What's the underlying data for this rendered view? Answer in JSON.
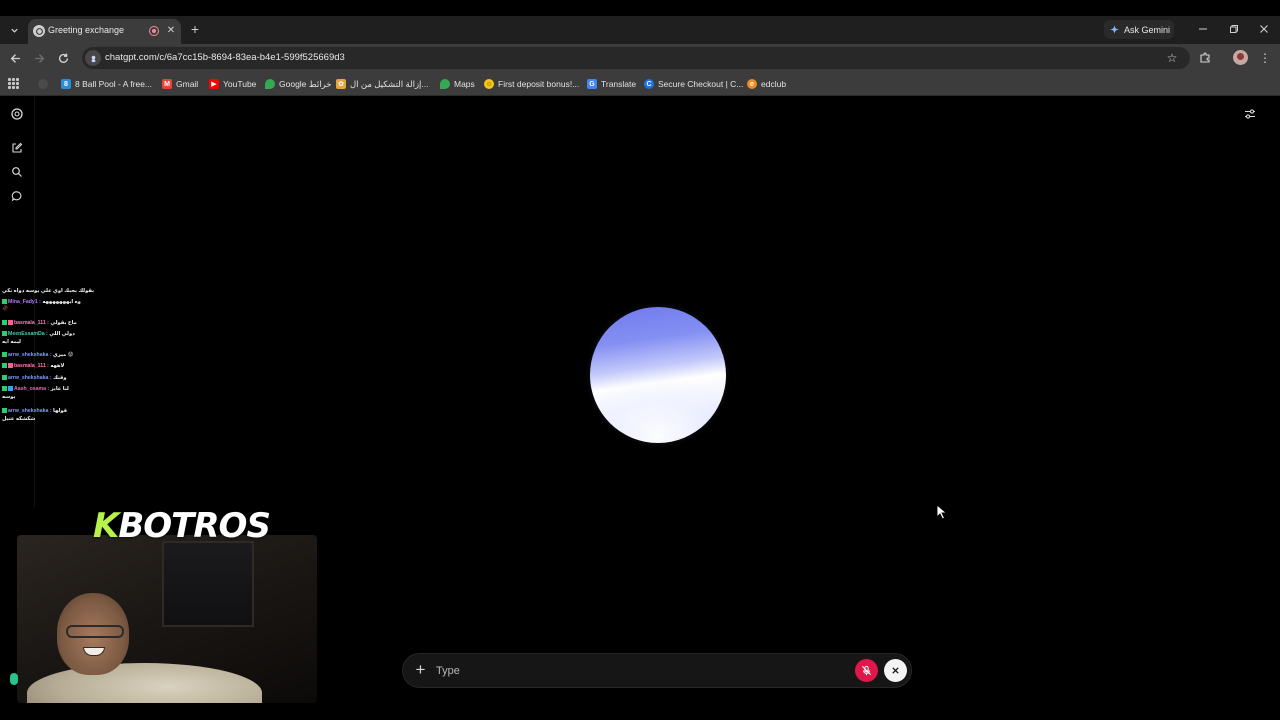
{
  "browser": {
    "tab_title": "Greeting exchange",
    "new_tab_label": "+",
    "ask_gemini_label": "Ask Gemini",
    "url": "chatgpt.com/c/6a7cc15b-8694-83ea-b4e1-599f525669d3",
    "bookmarks": [
      {
        "label": "8 Ball Pool - A free...",
        "icon": "8-ball-pool-icon",
        "color": "#2a8fd8"
      },
      {
        "label": "Gmail",
        "icon": "gmail-icon",
        "color": "#ea4335"
      },
      {
        "label": "YouTube",
        "icon": "youtube-icon",
        "color": "#ff0000"
      },
      {
        "label": "Google خرائط",
        "icon": "google-maps-icon",
        "color": "#34a853"
      },
      {
        "label": "إزالة التشكيل من ال...",
        "icon": "bookmark-site-icon",
        "color": "#e8a33c"
      },
      {
        "label": "Maps",
        "icon": "maps-pin-icon",
        "color": "#34a853"
      },
      {
        "label": "First deposit bonus!...",
        "icon": "smiley-icon",
        "color": "#f5c518"
      },
      {
        "label": "Translate",
        "icon": "translate-icon",
        "color": "#4285f4"
      },
      {
        "label": "Secure Checkout | C...",
        "icon": "c-logo-icon",
        "color": "#1a73e8"
      },
      {
        "label": "edclub",
        "icon": "edclub-icon",
        "color": "#f08a24"
      }
    ]
  },
  "composer": {
    "placeholder": "Type"
  },
  "stream": {
    "logo_prefix": "K",
    "logo_rest": "BOTROS",
    "chat": [
      {
        "user": "",
        "msg": "بقولك بحبك اوي علي يوسه دواه نكي",
        "color": "#ffffff"
      },
      {
        "user": "Mina_Fady1 :",
        "msg": "وه ايهههههههه",
        "color": "#b17cff"
      },
      {
        "user": "",
        "msg": "🥀",
        "color": "#ffffff"
      },
      {
        "user": "basmala_111 :",
        "msg": "ماخ بقولي",
        "color": "#ff7ab8"
      },
      {
        "user": "MeenEssamDa :",
        "msg": "دولي اللي",
        "color": "#3fd0b0"
      },
      {
        "user": "",
        "msg": "ليمه ايه",
        "color": "#ffffff"
      },
      {
        "user": "arrw_shekshaka :",
        "msg": "ميري 😡",
        "color": "#7b9cff"
      },
      {
        "user": "basmala_111 :",
        "msg": "لاههه",
        "color": "#ff7ab8"
      },
      {
        "user": "arrw_shekshaka :",
        "msg": "وقتك",
        "color": "#7b9cff"
      },
      {
        "user": "Aash_osama :",
        "msg": "لنا عايز",
        "color": "#ff5db1"
      },
      {
        "user": "",
        "msg": "يوسه",
        "color": "#ffffff"
      },
      {
        "user": "arrw_shekshaka :",
        "msg": "قولها",
        "color": "#7b9cff"
      },
      {
        "user": "",
        "msg": "شكشكه عتيل",
        "color": "#ffffff"
      }
    ]
  },
  "colors": {
    "mic_muted": "#e0174a",
    "orb_top": "#6f79ec",
    "orb_bottom": "#ffffff"
  }
}
